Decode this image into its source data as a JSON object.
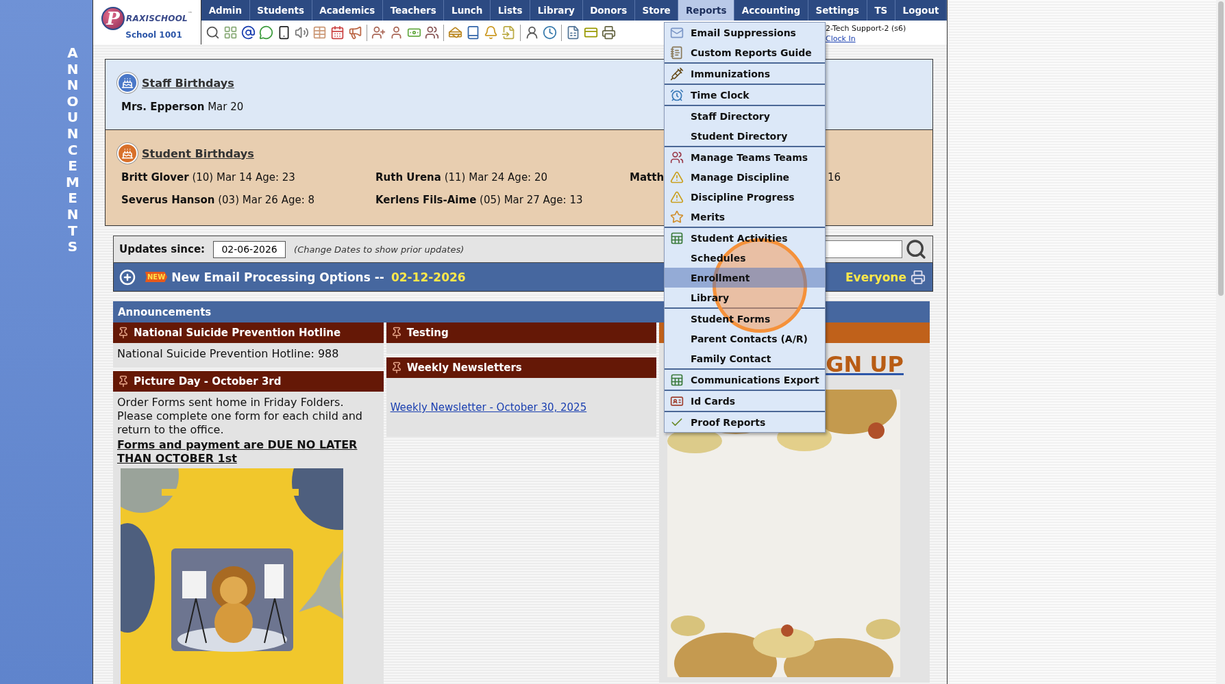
{
  "logo": {
    "initial": "P",
    "wordmark": "RAXISCHOOL",
    "trademark": "™",
    "school": "School 1001"
  },
  "nav": [
    {
      "label": "Admin",
      "selected": false
    },
    {
      "label": "Students",
      "selected": false
    },
    {
      "label": "Academics",
      "selected": false
    },
    {
      "label": "Teachers",
      "selected": false
    },
    {
      "label": "Lunch",
      "selected": false
    },
    {
      "label": "Lists",
      "selected": false
    },
    {
      "label": "Library",
      "selected": false
    },
    {
      "label": "Donors",
      "selected": false
    },
    {
      "label": "Store",
      "selected": false
    },
    {
      "label": "Reports",
      "selected": true
    },
    {
      "label": "Accounting",
      "selected": false
    },
    {
      "label": "Settings",
      "selected": false
    },
    {
      "label": "TS",
      "selected": false
    },
    {
      "label": "Logout",
      "selected": false
    }
  ],
  "user": {
    "name": "2-Tech Support-2 (s6)",
    "clock_link": "Clock In"
  },
  "side_banner": "ANNOUNCEMENTS",
  "staff_birthdays": {
    "title": "Staff Birthdays",
    "entries": [
      "**Mrs. Epperson** Mar 20"
    ]
  },
  "student_birthdays": {
    "title": "Student Birthdays",
    "rows": [
      {
        "cells": [
          {
            "kind": "full",
            "text": "**Britt Glover** (10) Mar 14 Age: 23"
          },
          {
            "kind": "full",
            "text": "**Ruth Urena** (11) Mar 24 Age: 20"
          },
          {
            "kind": "covered",
            "text": "**Matth**",
            "tail": "16"
          }
        ]
      },
      {
        "cells": [
          {
            "kind": "full",
            "text": "**Severus Hanson** (03) Mar 26 Age: 8"
          },
          {
            "kind": "full",
            "text": "**Kerlens Fils-Aime** (05) Mar 27 Age: 13"
          }
        ]
      }
    ]
  },
  "updates": {
    "label": "Updates since:",
    "date": "02-06-2026",
    "hint": "(Change Dates to show prior updates)"
  },
  "news": {
    "badge": "NEW",
    "title": "New Email Processing Options --",
    "date": "02-12-2026",
    "audience": "Everyone"
  },
  "announcements": {
    "title": "Announcements",
    "columns": [
      {
        "cards": [
          {
            "kind": "pinned",
            "color": "#651806",
            "title": "National Suicide Prevention Hotline",
            "body": [
              {
                "kind": "text",
                "text": "National Suicide Prevention Hotline: 988"
              }
            ]
          },
          {
            "kind": "pinned",
            "color": "#651806",
            "title": "Picture Day - October 3rd",
            "body": [
              {
                "kind": "text",
                "text": "Order Forms sent home in Friday Folders. Please complete one form for each child and return to the office."
              },
              {
                "kind": "emphasis",
                "text": "Forms and payment are DUE NO LATER THAN OCTOBER 1st"
              },
              {
                "kind": "picture"
              }
            ]
          }
        ]
      },
      {
        "cards": [
          {
            "kind": "pinned",
            "color": "#651806",
            "title": "Testing"
          },
          {
            "kind": "pinned",
            "color": "#651806",
            "title": "Weekly Newsletters",
            "body": [
              {
                "kind": "link",
                "text": "Weekly Newsletter - October 30, 2025"
              }
            ]
          }
        ]
      },
      {
        "cards": [
          {
            "kind": "covered",
            "color": "#c0611a",
            "body": [
              {
                "kind": "signup",
                "text": "GN UP"
              },
              {
                "kind": "picture"
              }
            ]
          }
        ]
      }
    ]
  },
  "menu": {
    "groups": [
      {
        "items": [
          {
            "label": "Email Suppressions",
            "selected": false
          },
          {
            "label": "Custom Reports Guide",
            "selected": false
          }
        ]
      },
      {
        "items": [
          {
            "label": "Immunizations",
            "selected": false
          }
        ]
      },
      {
        "items": [
          {
            "label": "Time Clock",
            "selected": false
          }
        ]
      },
      {
        "items": [
          {
            "label": "Staff Directory",
            "selected": false
          },
          {
            "label": "Student Directory",
            "selected": false
          }
        ]
      },
      {
        "items": [
          {
            "label": "Manage Teams Teams",
            "selected": false
          },
          {
            "label": "Manage Discipline",
            "selected": false
          },
          {
            "label": "Discipline Progress",
            "selected": false
          },
          {
            "label": "Merits",
            "selected": false
          }
        ]
      },
      {
        "items": [
          {
            "label": "Student Activities",
            "selected": false
          },
          {
            "label": "Schedules",
            "selected": false
          },
          {
            "label": "Enrollment",
            "selected": true
          },
          {
            "label": "Library",
            "selected": false
          }
        ]
      },
      {
        "items": [
          {
            "label": "Student Forms",
            "selected": false
          },
          {
            "label": "Parent Contacts (A/R)",
            "selected": false
          },
          {
            "label": "Family Contact",
            "selected": false
          }
        ]
      },
      {
        "items": [
          {
            "label": "Communications Export",
            "selected": false
          }
        ]
      },
      {
        "items": [
          {
            "label": "Id Cards",
            "selected": false
          }
        ]
      },
      {
        "items": [
          {
            "label": "Proof Reports",
            "selected": false
          }
        ]
      }
    ]
  }
}
